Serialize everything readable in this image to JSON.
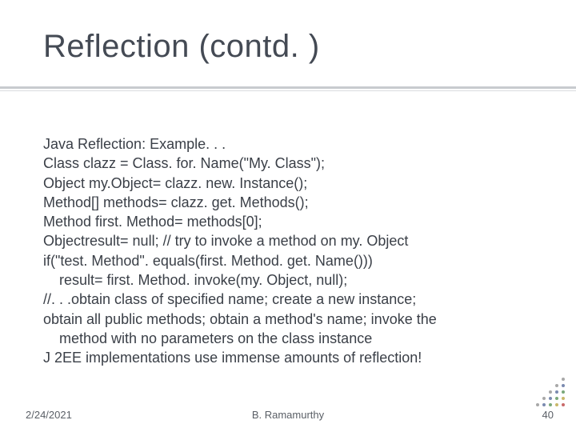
{
  "title": "Reflection (contd. )",
  "body": {
    "lines": [
      "Java Reflection: Example. . .",
      "Class clazz = Class. for. Name(\"My. Class\");",
      "Object my.Object= clazz. new. Instance();",
      "Method[] methods= clazz. get. Methods();",
      "Method first. Method= methods[0];",
      "Objectresult= null; // try to invoke a method on my. Object",
      "if(\"test. Method\". equals(first. Method. get. Name()))",
      "  result= first. Method. invoke(my. Object, null);",
      "//. . .obtain class of specified name; create a new instance;",
      " obtain all public methods; obtain a method's name; invoke the",
      "   method with no parameters on the class instance",
      "J 2EE implementations use immense amounts of reflection!"
    ]
  },
  "footer": {
    "date": "2/24/2021",
    "author": "B. Ramamurthy",
    "page": "40"
  }
}
